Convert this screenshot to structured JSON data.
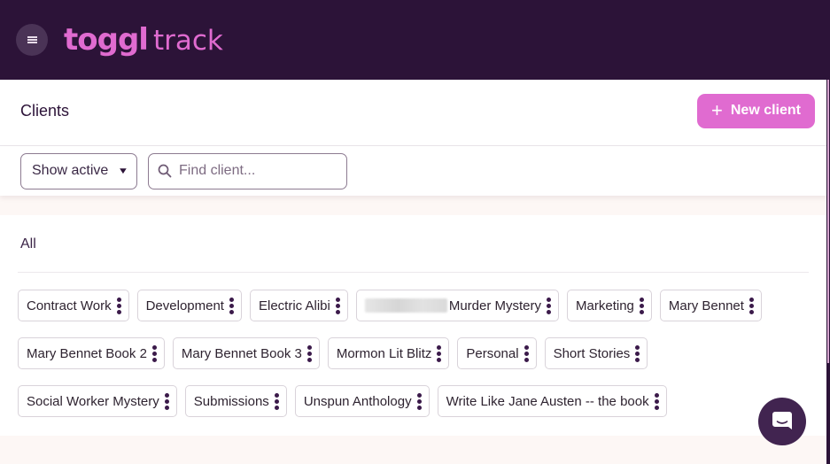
{
  "app": {
    "logo_bold": "toggl",
    "logo_light": "track",
    "menu_icon": "hamburger-icon"
  },
  "header": {
    "title": "Clients",
    "new_client_label": "New client",
    "new_client_icon": "plus-icon"
  },
  "filters": {
    "status_select": {
      "selected": "Show active",
      "icon": "chevron-down-icon"
    },
    "search": {
      "value": "",
      "placeholder": "Find client...",
      "icon": "search-icon"
    }
  },
  "section": {
    "label": "All"
  },
  "clients": [
    {
      "name": "Contract Work"
    },
    {
      "name": "Development"
    },
    {
      "name": "Electric Alibi"
    },
    {
      "name": "Murder Mystery",
      "redacted_prefix": true
    },
    {
      "name": "Marketing"
    },
    {
      "name": "Mary Bennet"
    },
    {
      "name": "Mary Bennet Book 2"
    },
    {
      "name": "Mary Bennet Book 3"
    },
    {
      "name": "Mormon Lit Blitz"
    },
    {
      "name": "Personal"
    },
    {
      "name": "Short Stories"
    },
    {
      "name": "Social Worker Mystery"
    },
    {
      "name": "Submissions"
    },
    {
      "name": "Unspun Anthology"
    },
    {
      "name": "Write Like Jane Austen -- the book"
    }
  ],
  "chat_widget": {
    "icon": "chat-bubble-icon"
  },
  "colors": {
    "topbar": "#2c1338",
    "brand_pink": "#e06bd0",
    "page_bg": "#fdf7f5",
    "chat_button": "#412450"
  }
}
